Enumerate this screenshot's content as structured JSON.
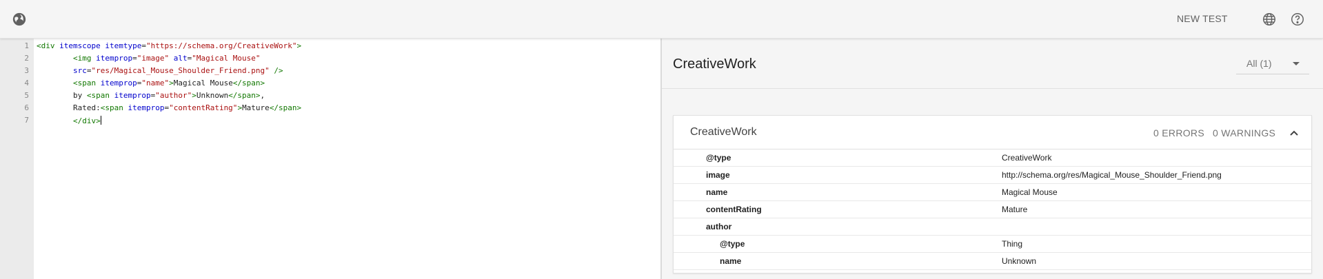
{
  "topbar": {
    "new_test_label": "NEW TEST"
  },
  "editor": {
    "line_numbers": [
      "1",
      "2",
      "3",
      "4",
      "5",
      "6",
      "7"
    ],
    "lines": [
      {
        "indent": "",
        "parts": [
          [
            "tag",
            "<div "
          ],
          [
            "attr",
            "itemscope itemtype"
          ],
          [
            "plain",
            "="
          ],
          [
            "str",
            "\"https://schema.org/CreativeWork\""
          ],
          [
            "tag",
            ">"
          ]
        ]
      },
      {
        "indent": "        ",
        "parts": [
          [
            "tag",
            "<img "
          ],
          [
            "attr",
            "itemprop"
          ],
          [
            "plain",
            "="
          ],
          [
            "str",
            "\"image\""
          ],
          [
            "plain",
            " "
          ],
          [
            "attr",
            "alt"
          ],
          [
            "plain",
            "="
          ],
          [
            "str",
            "\"Magical Mouse\""
          ]
        ]
      },
      {
        "indent": "        ",
        "parts": [
          [
            "attr",
            "src"
          ],
          [
            "plain",
            "="
          ],
          [
            "str",
            "\"res/Magical_Mouse_Shoulder_Friend.png\""
          ],
          [
            "plain",
            " "
          ],
          [
            "tag",
            "/>"
          ]
        ]
      },
      {
        "indent": "        ",
        "parts": [
          [
            "tag",
            "<span "
          ],
          [
            "attr",
            "itemprop"
          ],
          [
            "plain",
            "="
          ],
          [
            "str",
            "\"name\""
          ],
          [
            "tag",
            ">"
          ],
          [
            "plain",
            "Magical Mouse"
          ],
          [
            "tag",
            "</span>"
          ]
        ]
      },
      {
        "indent": "        ",
        "parts": [
          [
            "plain",
            "by "
          ],
          [
            "tag",
            "<span "
          ],
          [
            "attr",
            "itemprop"
          ],
          [
            "plain",
            "="
          ],
          [
            "str",
            "\"author\""
          ],
          [
            "tag",
            ">"
          ],
          [
            "plain",
            "Unknown"
          ],
          [
            "tag",
            "</span>"
          ],
          [
            "plain",
            ","
          ]
        ]
      },
      {
        "indent": "        ",
        "parts": [
          [
            "plain",
            "Rated:"
          ],
          [
            "tag",
            "<span "
          ],
          [
            "attr",
            "itemprop"
          ],
          [
            "plain",
            "="
          ],
          [
            "str",
            "\"contentRating\""
          ],
          [
            "tag",
            ">"
          ],
          [
            "plain",
            "Mature"
          ],
          [
            "tag",
            "</span>"
          ]
        ]
      },
      {
        "indent": "        ",
        "parts": [
          [
            "tag",
            "</div>"
          ]
        ]
      }
    ]
  },
  "results": {
    "title": "CreativeWork",
    "filter_label": "All (1)",
    "card": {
      "title": "CreativeWork",
      "errors": "0 ERRORS",
      "warnings": "0 WARNINGS",
      "rows": [
        {
          "name": "@type",
          "value": "CreativeWork",
          "nested": false
        },
        {
          "name": "image",
          "value": "http://schema.org/res/Magical_Mouse_Shoulder_Friend.png",
          "nested": false
        },
        {
          "name": "name",
          "value": "Magical Mouse",
          "nested": false
        },
        {
          "name": "contentRating",
          "value": "Mature",
          "nested": false
        },
        {
          "name": "author",
          "value": "",
          "nested": false
        },
        {
          "name": "@type",
          "value": "Thing",
          "nested": true
        },
        {
          "name": "name",
          "value": "Unknown",
          "nested": true
        }
      ]
    }
  },
  "colors": {
    "tag": "#117700",
    "attr": "#0000cc",
    "string": "#aa1111",
    "topbar_bg": "#f5f5f5",
    "gutter_bg": "#ebebeb"
  },
  "icons": {
    "logo": "globe-pin-icon",
    "language": "globe-icon",
    "help": "help-circle-icon",
    "collapse": "chevron-up-icon",
    "dropdown": "dropdown-arrow-icon"
  }
}
